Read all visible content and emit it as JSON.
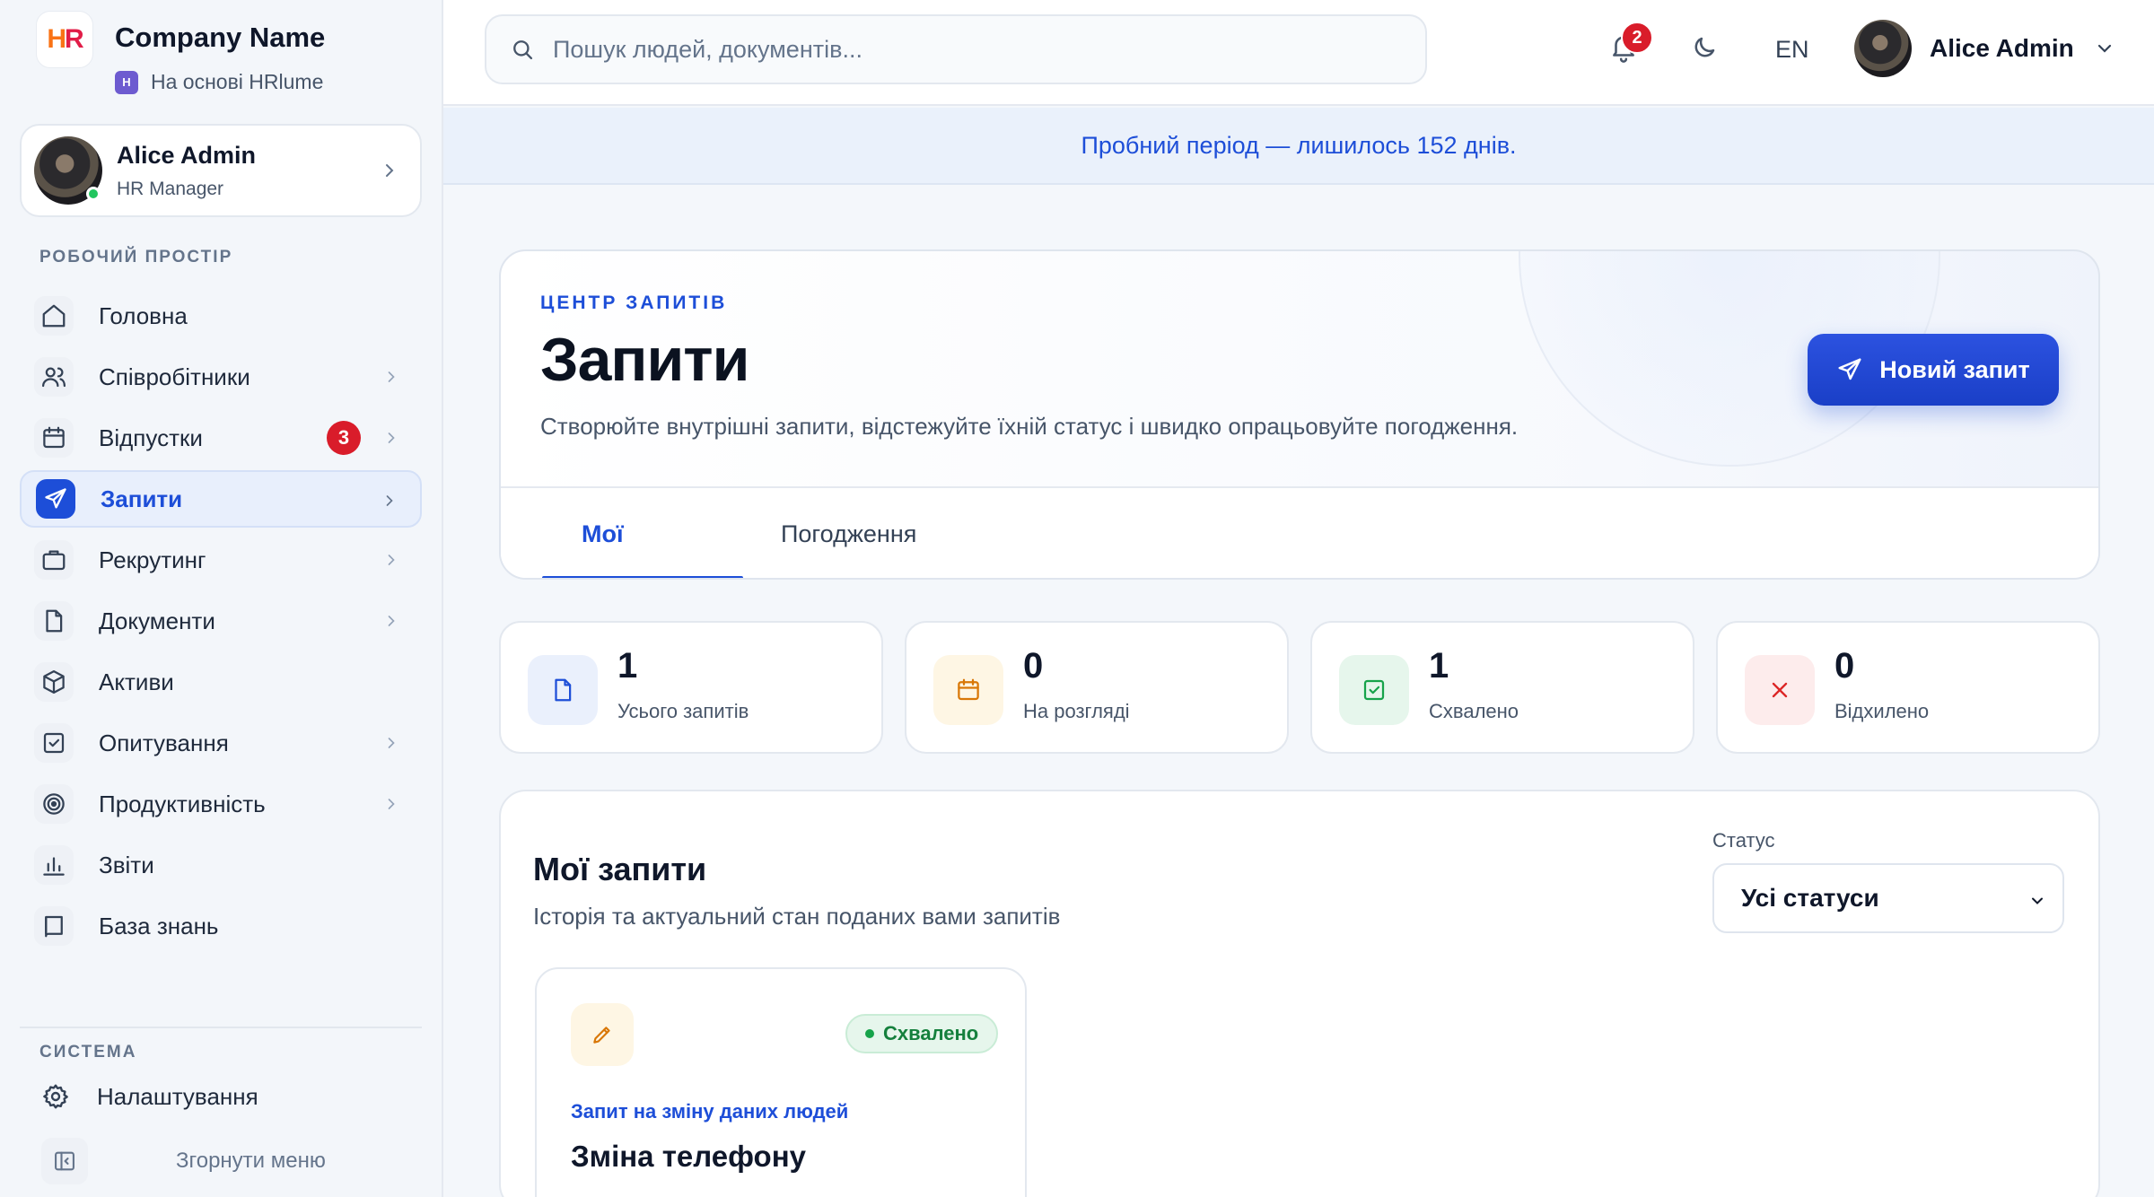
{
  "brand": {
    "company_name": "Company Name",
    "powered_by": "На основі HRlume",
    "logo_text_h": "H",
    "logo_text_r": "R"
  },
  "current_user": {
    "name": "Alice Admin",
    "role": "HR Manager",
    "online": true
  },
  "sidebar": {
    "workspace_label": "РОБОЧИЙ ПРОСТІР",
    "items": [
      {
        "label": "Головна",
        "icon": "home-icon",
        "has_chevron": false
      },
      {
        "label": "Співробітники",
        "icon": "users-icon",
        "has_chevron": true
      },
      {
        "label": "Відпустки",
        "icon": "calendar-icon",
        "has_chevron": true,
        "badge": "3"
      },
      {
        "label": "Запити",
        "icon": "send-icon",
        "has_chevron": true,
        "active": true
      },
      {
        "label": "Рекрутинг",
        "icon": "briefcase-icon",
        "has_chevron": true
      },
      {
        "label": "Документи",
        "icon": "file-icon",
        "has_chevron": true
      },
      {
        "label": "Активи",
        "icon": "box-icon",
        "has_chevron": false
      },
      {
        "label": "Опитування",
        "icon": "check-square-icon",
        "has_chevron": true
      },
      {
        "label": "Продуктивність",
        "icon": "target-icon",
        "has_chevron": true
      },
      {
        "label": "Звіти",
        "icon": "bar-chart-icon",
        "has_chevron": false
      },
      {
        "label": "База знань",
        "icon": "book-icon",
        "has_chevron": false
      }
    ],
    "system_label": "СИСТЕМА",
    "settings_label": "Налаштування",
    "collapse_label": "Згорнути меню"
  },
  "topbar": {
    "search_placeholder": "Пошук людей, документів...",
    "notifications_count": "2",
    "language": "EN",
    "user_name": "Alice Admin"
  },
  "trial_banner": "Пробний період — лишилось 152 днів.",
  "hero": {
    "eyebrow": "ЦЕНТР ЗАПИТІВ",
    "title": "Запити",
    "subtitle": "Створюйте внутрішні запити, відстежуйте їхній статус і швидко опрацьовуйте погодження.",
    "new_button": "Новий запит",
    "tabs": [
      {
        "label": "Мої",
        "active": true
      },
      {
        "label": "Погодження",
        "active": false
      }
    ]
  },
  "stats": [
    {
      "value": "1",
      "caption": "Усього запитів",
      "icon": "file-icon",
      "bg": "#eaf0fc",
      "color": "#1d4ed8"
    },
    {
      "value": "0",
      "caption": "На розгляді",
      "icon": "calendar-icon",
      "bg": "#fef6e4",
      "color": "#d97706"
    },
    {
      "value": "1",
      "caption": "Схвалено",
      "icon": "check-square-icon",
      "bg": "#e6f6ec",
      "color": "#16a34a"
    },
    {
      "value": "0",
      "caption": "Відхилено",
      "icon": "x-icon",
      "bg": "#fdecec",
      "color": "#dc2626"
    }
  ],
  "my_requests": {
    "title": "Мої запити",
    "subtitle": "Історія та актуальний стан поданих вами запитів",
    "status_filter_label": "Статус",
    "status_filter_value": "Усі статуси",
    "cards": [
      {
        "status": "Схвалено",
        "category": "Запит на зміну даних людей",
        "title": "Зміна телефону"
      }
    ]
  },
  "colors": {
    "accent": "#1d4ed8",
    "danger": "#d91c2a",
    "success": "#16a34a"
  }
}
